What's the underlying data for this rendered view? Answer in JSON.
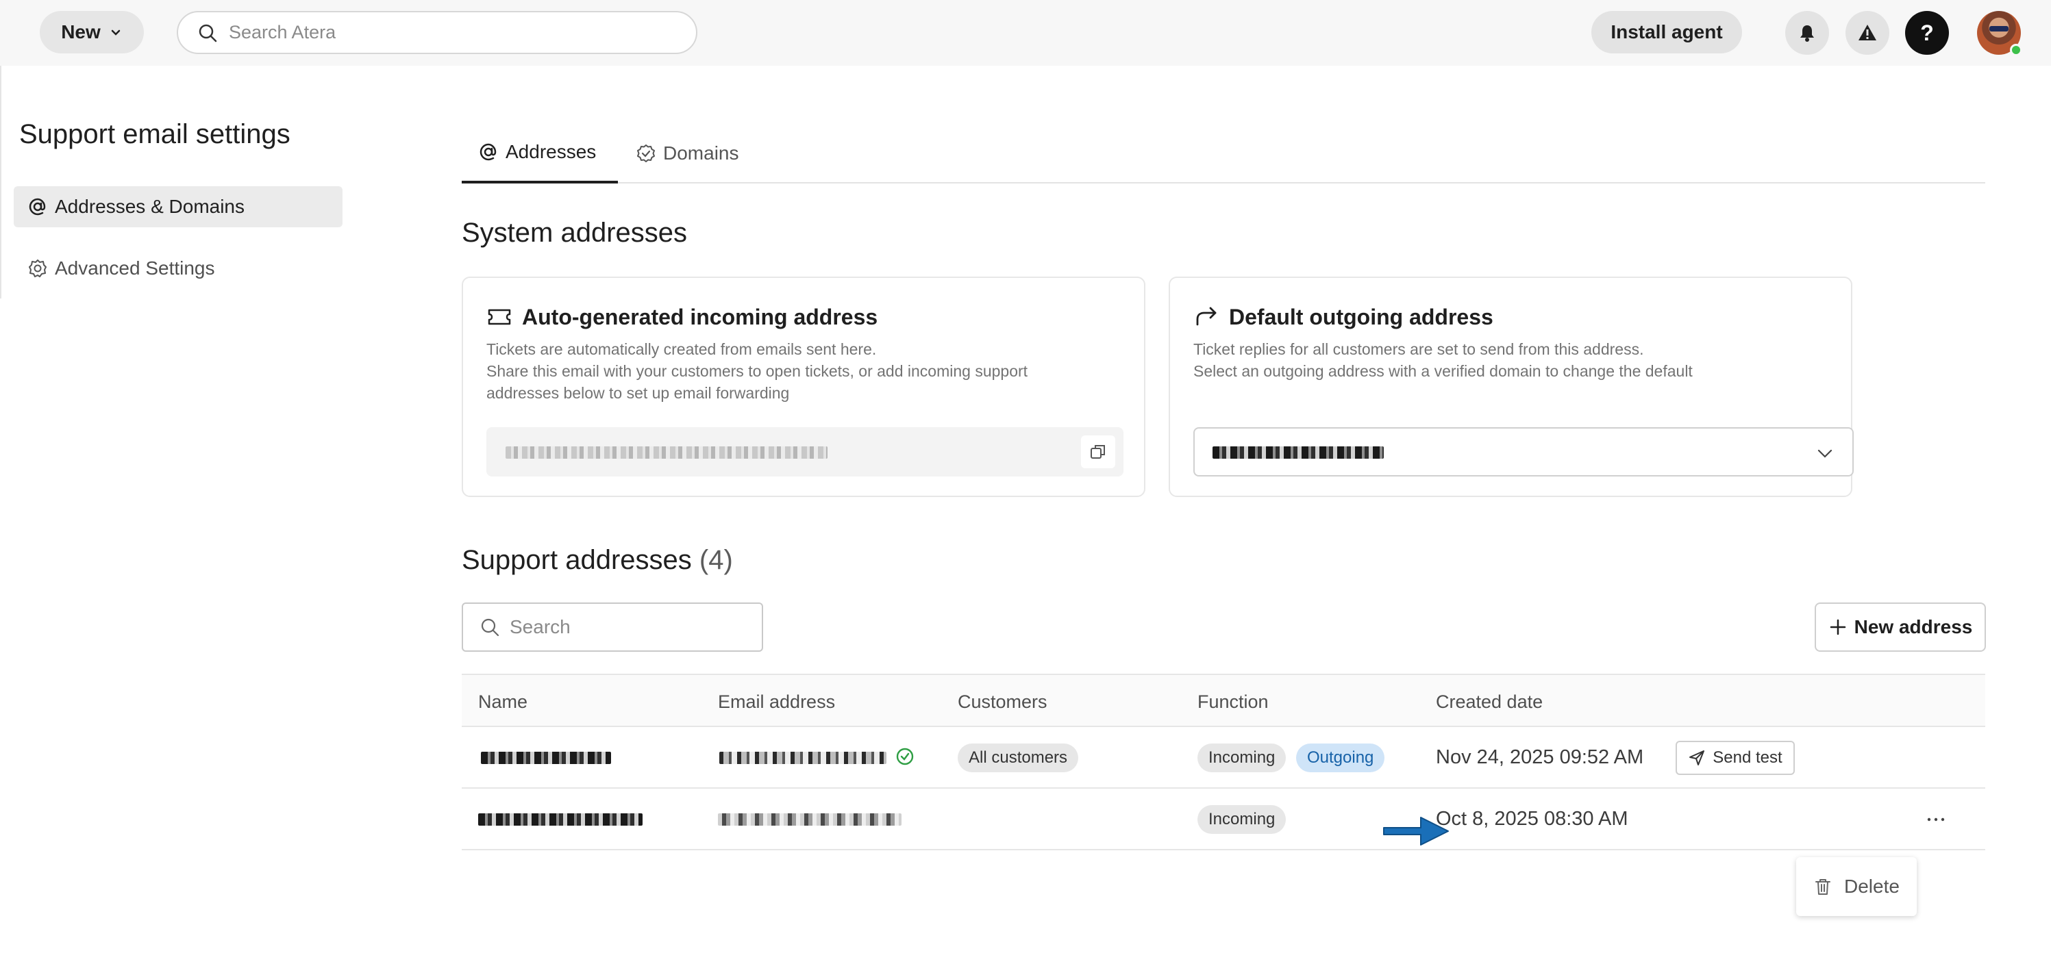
{
  "topbar": {
    "new_label": "New",
    "search_placeholder": "Search Atera",
    "install_agent_label": "Install agent",
    "help_label": "?"
  },
  "sidebar": {
    "title": "Support email settings",
    "items": [
      {
        "label": "Addresses & Domains",
        "icon": "at-icon",
        "active": true
      },
      {
        "label": "Advanced Settings",
        "icon": "gear-icon",
        "active": false
      }
    ]
  },
  "tabs": [
    {
      "label": "Addresses",
      "icon": "at-icon",
      "active": true
    },
    {
      "label": "Domains",
      "icon": "verified-badge-icon",
      "active": false
    }
  ],
  "system_addresses": {
    "title": "System addresses",
    "incoming": {
      "title": "Auto-generated incoming address",
      "desc_lines": [
        "Tickets are automatically created from emails sent here.",
        "Share this email with your customers to open tickets, or add incoming support",
        "addresses below to set up email forwarding"
      ]
    },
    "outgoing": {
      "title": "Default outgoing address",
      "desc_lines": [
        "Ticket replies for all customers are set to send from this address.",
        "Select an outgoing address with a verified domain to change the default"
      ]
    }
  },
  "support_addresses": {
    "title": "Support addresses",
    "count": "(4)",
    "search_placeholder": "Search",
    "new_address_label": "New address",
    "columns": [
      "Name",
      "Email address",
      "Customers",
      "Function",
      "Created date"
    ],
    "rows": [
      {
        "customers": "All customers",
        "functions": [
          "Incoming",
          "Outgoing"
        ],
        "created": "Nov 24, 2025 09:52 AM",
        "action": "Send test"
      },
      {
        "customers": "",
        "functions": [
          "Incoming"
        ],
        "created": "Oct 8, 2025 08:30 AM",
        "action": ""
      }
    ],
    "row_menu": {
      "delete_label": "Delete"
    }
  },
  "colors": {
    "accent_blue": "#1762a8",
    "outgoing_pill_bg": "#cfe4f8",
    "arrow_blue": "#1a6fb8",
    "verified_green": "#2f9e44"
  }
}
